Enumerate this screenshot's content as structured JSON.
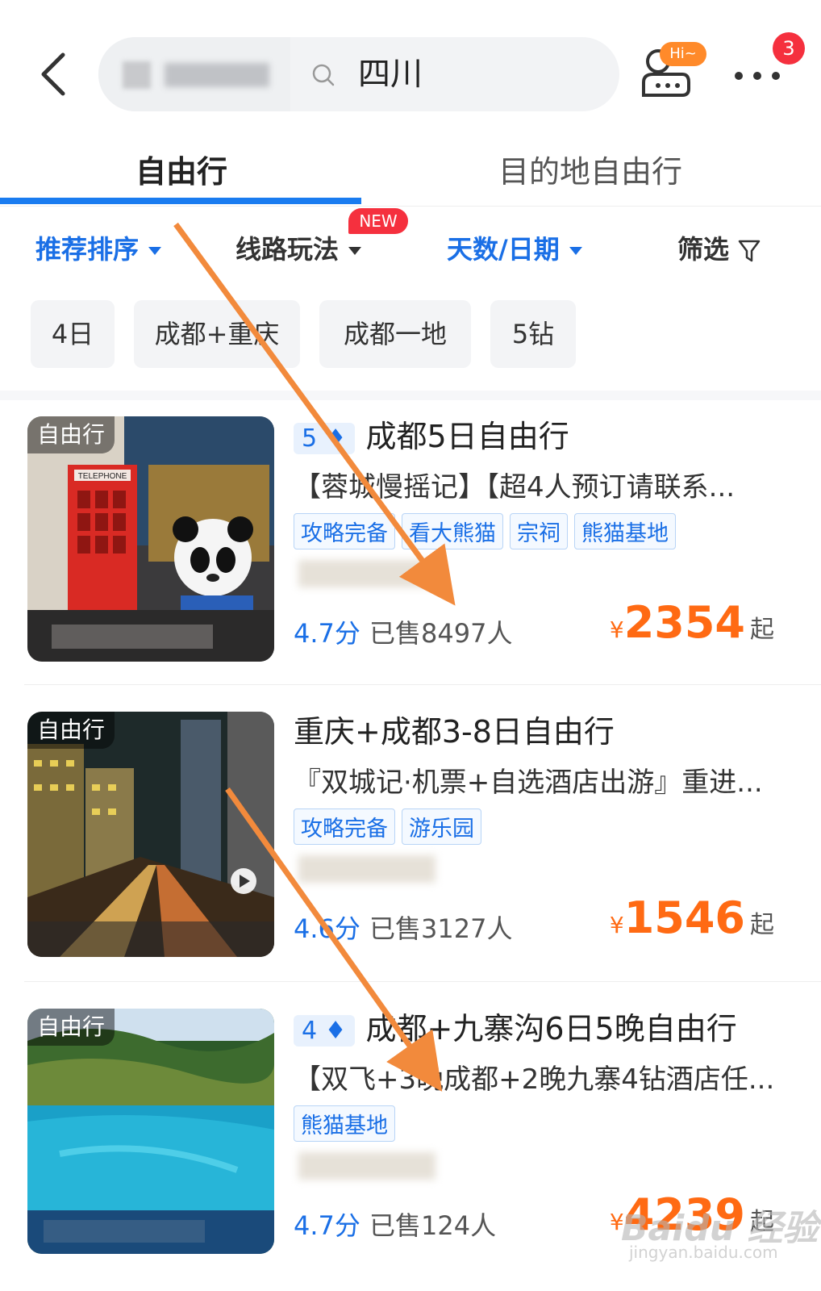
{
  "header": {
    "search_value": "四川",
    "chat_badge": "Hi~",
    "notification_count": "3"
  },
  "tabs": [
    {
      "label": "自由行",
      "active": true
    },
    {
      "label": "目的地自由行",
      "active": false
    }
  ],
  "filters": {
    "sort": "推荐排序",
    "route": "线路玩法",
    "route_badge": "NEW",
    "days": "天数/日期",
    "screen": "筛选"
  },
  "chips": [
    "4日",
    "成都+重庆",
    "成都一地",
    "5钻"
  ],
  "products": [
    {
      "thumb_tag": "自由行",
      "diamond": "5",
      "title": "成都5日自由行",
      "subtitle": "【蓉城慢摇记】【超4人预订请联系...",
      "tags": [
        "攻略完备",
        "看大熊猫",
        "宗祠",
        "熊猫基地"
      ],
      "rating": "4.7分",
      "sold": "已售8497人",
      "currency": "¥",
      "price": "2354",
      "price_suffix": "起"
    },
    {
      "thumb_tag": "自由行",
      "diamond": "",
      "title": "重庆+成都3-8日自由行",
      "subtitle": "『双城记·机票+自选酒店出游』重进...",
      "tags": [
        "攻略完备",
        "游乐园"
      ],
      "rating": "4.6分",
      "sold": "已售3127人",
      "currency": "¥",
      "price": "1546",
      "price_suffix": "起"
    },
    {
      "thumb_tag": "自由行",
      "diamond": "4",
      "title": "成都+九寨沟6日5晚自由行",
      "subtitle": "【双飞+3晚成都+2晚九寨4钻酒店任...",
      "tags": [
        "熊猫基地"
      ],
      "rating": "4.7分",
      "sold": "已售124人",
      "currency": "¥",
      "price": "4239",
      "price_suffix": "起"
    }
  ],
  "colors": {
    "accent": "#1a6fe6",
    "price": "#ff6a13",
    "badge": "#f5303e",
    "arrow": "#f28a3c"
  }
}
